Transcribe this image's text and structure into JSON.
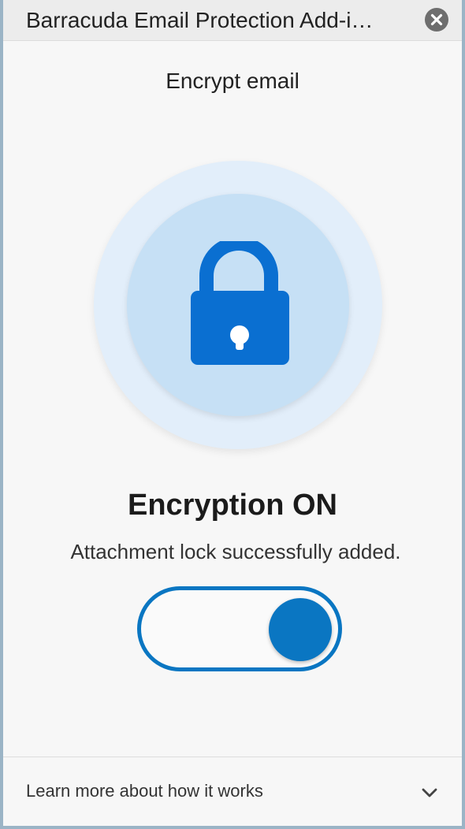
{
  "window": {
    "title": "Barracuda Email Protection Add-i…",
    "close_icon": "close-icon"
  },
  "panel": {
    "subtitle": "Encrypt email",
    "lock_icon": "lock-icon",
    "status_title": "Encryption ON",
    "status_description": "Attachment lock successfully added.",
    "toggle": {
      "state": "on"
    }
  },
  "footer": {
    "learn_more_label": "Learn more about how it works",
    "expand_icon": "chevron-down-icon"
  },
  "colors": {
    "accent": "#0a76c2",
    "lock": "#0a6fd1",
    "outer_circle": "#e2eefa",
    "inner_circle": "#c6e0f5"
  }
}
